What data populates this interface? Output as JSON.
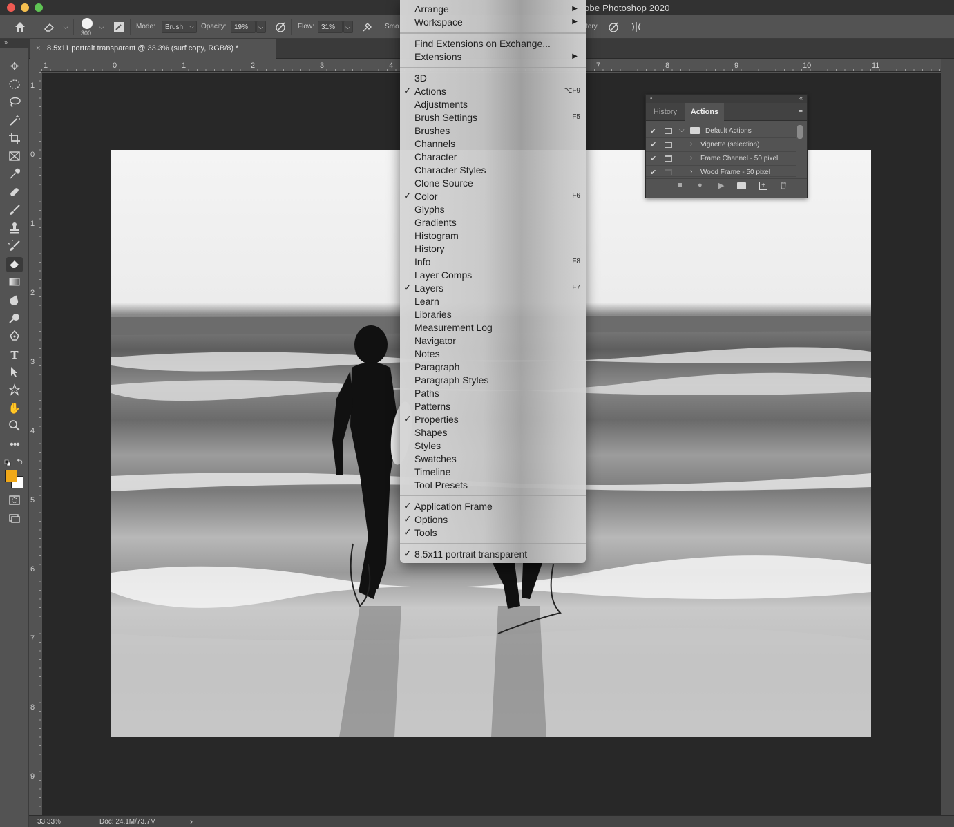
{
  "window": {
    "title": "obe Photoshop 2020"
  },
  "options_bar": {
    "brush_size": "300",
    "mode_label": "Mode:",
    "mode_value": "Brush",
    "opacity_label": "Opacity:",
    "opacity_value": "19%",
    "flow_label": "Flow:",
    "flow_value": "31%",
    "smoothing_label": "Smo",
    "history_label": "tory"
  },
  "document_tab": {
    "title": "8.5x11 portrait transparent @ 33.3% (surf copy, RGB/8) *",
    "close": "×"
  },
  "ruler_h": [
    "1",
    "0",
    "1",
    "2",
    "3",
    "4",
    "7",
    "8",
    "9",
    "10",
    "11"
  ],
  "ruler_v": [
    "1",
    "0",
    "1",
    "2",
    "3",
    "4",
    "5",
    "6",
    "7",
    "8",
    "9"
  ],
  "status_bar": {
    "zoom": "33.33%",
    "doc_size": "Doc: 24.1M/73.7M",
    "arrow": "›"
  },
  "colors": {
    "foreground": "#f0a818",
    "background": "#ffffff"
  },
  "window_menu": {
    "items": [
      {
        "label": "Arrange",
        "checked": false,
        "shortcut": "",
        "submenu": true
      },
      {
        "label": "Workspace",
        "checked": false,
        "shortcut": "",
        "submenu": true
      },
      {
        "label": "Find Extensions on Exchange...",
        "checked": false,
        "shortcut": "",
        "submenu": false
      },
      {
        "label": "Extensions",
        "checked": false,
        "shortcut": "",
        "submenu": true
      },
      {
        "label": "3D",
        "checked": false,
        "shortcut": "",
        "submenu": false
      },
      {
        "label": "Actions",
        "checked": true,
        "shortcut": "⌥F9",
        "submenu": false
      },
      {
        "label": "Adjustments",
        "checked": false,
        "shortcut": "",
        "submenu": false
      },
      {
        "label": "Brush Settings",
        "checked": false,
        "shortcut": "F5",
        "submenu": false
      },
      {
        "label": "Brushes",
        "checked": false,
        "shortcut": "",
        "submenu": false
      },
      {
        "label": "Channels",
        "checked": false,
        "shortcut": "",
        "submenu": false
      },
      {
        "label": "Character",
        "checked": false,
        "shortcut": "",
        "submenu": false
      },
      {
        "label": "Character Styles",
        "checked": false,
        "shortcut": "",
        "submenu": false
      },
      {
        "label": "Clone Source",
        "checked": false,
        "shortcut": "",
        "submenu": false
      },
      {
        "label": "Color",
        "checked": true,
        "shortcut": "F6",
        "submenu": false
      },
      {
        "label": "Glyphs",
        "checked": false,
        "shortcut": "",
        "submenu": false
      },
      {
        "label": "Gradients",
        "checked": false,
        "shortcut": "",
        "submenu": false
      },
      {
        "label": "Histogram",
        "checked": false,
        "shortcut": "",
        "submenu": false
      },
      {
        "label": "History",
        "checked": false,
        "shortcut": "",
        "submenu": false
      },
      {
        "label": "Info",
        "checked": false,
        "shortcut": "F8",
        "submenu": false
      },
      {
        "label": "Layer Comps",
        "checked": false,
        "shortcut": "",
        "submenu": false
      },
      {
        "label": "Layers",
        "checked": true,
        "shortcut": "F7",
        "submenu": false
      },
      {
        "label": "Learn",
        "checked": false,
        "shortcut": "",
        "submenu": false
      },
      {
        "label": "Libraries",
        "checked": false,
        "shortcut": "",
        "submenu": false
      },
      {
        "label": "Measurement Log",
        "checked": false,
        "shortcut": "",
        "submenu": false
      },
      {
        "label": "Navigator",
        "checked": false,
        "shortcut": "",
        "submenu": false
      },
      {
        "label": "Notes",
        "checked": false,
        "shortcut": "",
        "submenu": false
      },
      {
        "label": "Paragraph",
        "checked": false,
        "shortcut": "",
        "submenu": false
      },
      {
        "label": "Paragraph Styles",
        "checked": false,
        "shortcut": "",
        "submenu": false
      },
      {
        "label": "Paths",
        "checked": false,
        "shortcut": "",
        "submenu": false
      },
      {
        "label": "Patterns",
        "checked": false,
        "shortcut": "",
        "submenu": false
      },
      {
        "label": "Properties",
        "checked": true,
        "shortcut": "",
        "submenu": false
      },
      {
        "label": "Shapes",
        "checked": false,
        "shortcut": "",
        "submenu": false
      },
      {
        "label": "Styles",
        "checked": false,
        "shortcut": "",
        "submenu": false
      },
      {
        "label": "Swatches",
        "checked": false,
        "shortcut": "",
        "submenu": false
      },
      {
        "label": "Timeline",
        "checked": false,
        "shortcut": "",
        "submenu": false
      },
      {
        "label": "Tool Presets",
        "checked": false,
        "shortcut": "",
        "submenu": false
      },
      {
        "label": "Application Frame",
        "checked": true,
        "shortcut": "",
        "submenu": false
      },
      {
        "label": "Options",
        "checked": true,
        "shortcut": "",
        "submenu": false
      },
      {
        "label": "Tools",
        "checked": true,
        "shortcut": "",
        "submenu": false
      },
      {
        "label": "8.5x11 portrait transparent",
        "checked": true,
        "shortcut": "",
        "submenu": false
      }
    ]
  },
  "actions_panel": {
    "tabs": [
      "History",
      "Actions"
    ],
    "active_tab": "Actions",
    "rows": [
      {
        "label": "Default Actions",
        "type": "set",
        "expander": "⌵"
      },
      {
        "label": "Vignette (selection)",
        "type": "action",
        "expander": "›"
      },
      {
        "label": "Frame Channel - 50 pixel",
        "type": "action",
        "expander": "›"
      },
      {
        "label": "Wood Frame - 50 pixel",
        "type": "action",
        "expander": "›"
      }
    ]
  }
}
